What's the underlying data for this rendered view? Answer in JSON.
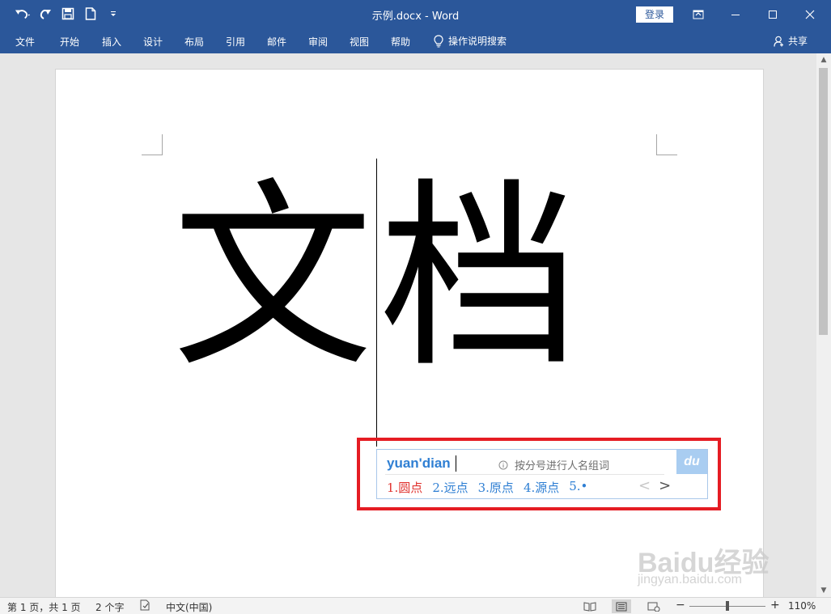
{
  "window": {
    "title": "示例.docx - Word",
    "login_label": "登录"
  },
  "ribbon": {
    "tabs": [
      "文件",
      "开始",
      "插入",
      "设计",
      "布局",
      "引用",
      "邮件",
      "审阅",
      "视图",
      "帮助"
    ],
    "tell_me": "操作说明搜索",
    "share": "共享"
  },
  "document": {
    "chars": [
      "文",
      "档"
    ]
  },
  "ime": {
    "pinyin": "yuan'dian",
    "hint": "按分号进行人名组词",
    "logo": "du",
    "candidates": [
      "1.圆点",
      "2.远点",
      "3.原点",
      "4.源点",
      "5.•"
    ],
    "prev": "<",
    "next": ">"
  },
  "watermark": {
    "main": "Baidu经验",
    "sub": "jingyan.baidu.com"
  },
  "status": {
    "page": "第 1 页，共 1 页",
    "words": "2 个字",
    "language": "中文(中国)",
    "zoom_minus": "−",
    "zoom_plus": "+",
    "zoom": "110%"
  },
  "colors": {
    "title_bar": "#2b579a",
    "ime_highlight": "#e51c23",
    "ime_candidate": "#2f7fd3",
    "ime_selected": "#e0332f"
  }
}
